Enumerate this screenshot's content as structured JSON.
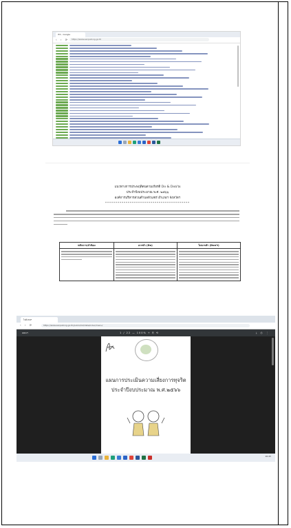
{
  "browser_list": {
    "tab_label": "ITA - Google",
    "url": "https://www.sanpatong.go.th",
    "row_count": 38
  },
  "document": {
    "title_line1": "แนวทางการประพฤติตนตามเกียรติ Do & Don'ts",
    "title_line2": "ประจำปีงบประมาณ พ.ศ. ๒๕๖๖",
    "title_line3": "องค์การบริหารส่วนตำบลหัวแซร่ อำเภอฯ จังหวัดฯ",
    "stars": "*****************************************",
    "table": {
      "headers": [
        "หลักการ/คำนิยม",
        "ควรทำ (Do)",
        "ไม่ควรทำ (Don't)"
      ]
    }
  },
  "pdf_viewer": {
    "tab_label": "ไฟล์ PDF",
    "url": "https://www.sanpatong.go.th/public/list/data/index/menu/",
    "file_name": "แผนฯ",
    "page_controls": "1 / 22  —  100%  +  ⎘  ⟲",
    "toolbar_right": "⤓ ⎙ ⋮",
    "heading1": "แผนการประเมินความเสี่ยงการทุจริต",
    "heading2": "ประจำปีงบประมาณ พ.ศ.๒๕๖๖",
    "clock": "16:45"
  }
}
